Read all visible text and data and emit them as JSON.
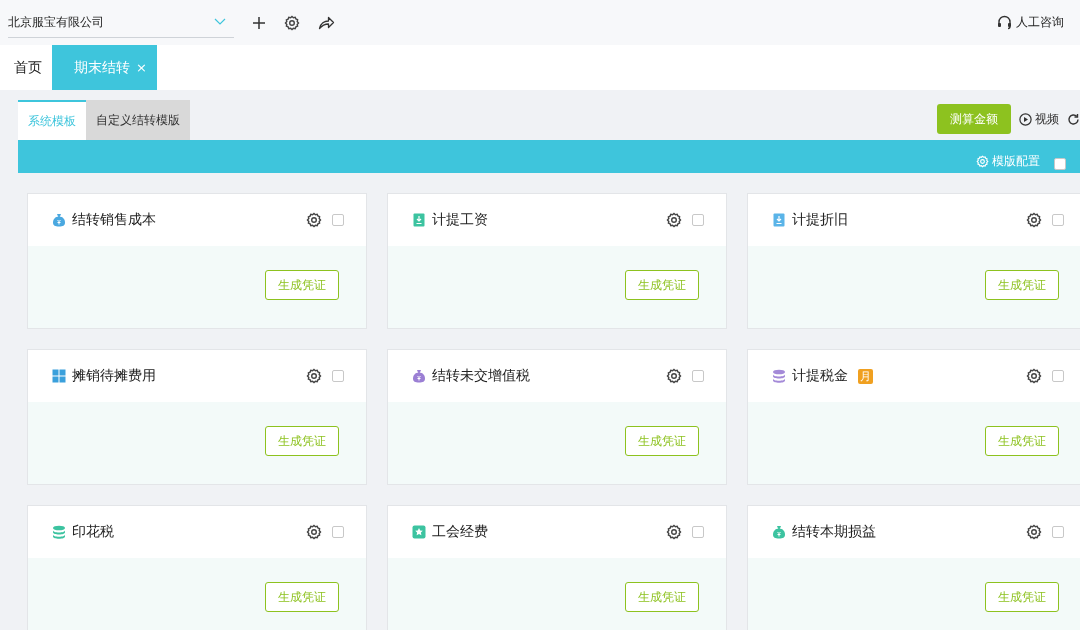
{
  "top_bar": {
    "company": "北京服宝有限公司",
    "support": "人工咨询"
  },
  "page_tabs": [
    {
      "label": "首页",
      "selected": false,
      "closable": false
    },
    {
      "label": "期末结转",
      "selected": true,
      "closable": true
    }
  ],
  "close_glyph": "×",
  "template_tabs": [
    {
      "label": "系统模板",
      "selected": true
    },
    {
      "label": "自定义结转模版",
      "selected": false
    }
  ],
  "actions": {
    "calculate": "测算金额",
    "video": "视频"
  },
  "band": {
    "config": "模版配置",
    "select_all": {
      "checked": false
    }
  },
  "cards": [
    {
      "title": "结转销售成本",
      "kind": "bag",
      "color": "#4aa8e0",
      "checked": false,
      "button": "生成凭证"
    },
    {
      "title": "计提工资",
      "kind": "doc",
      "color": "#3cc3a0",
      "checked": false,
      "button": "生成凭证"
    },
    {
      "title": "计提折旧",
      "kind": "doc",
      "color": "#5ab4e8",
      "checked": false,
      "button": "生成凭证"
    },
    {
      "title": "摊销待摊费用",
      "kind": "grid",
      "color": "#3aa0dc",
      "checked": false,
      "button": "生成凭证"
    },
    {
      "title": "结转未交增值税",
      "kind": "bag",
      "color": "#9b7fd4",
      "checked": false,
      "button": "生成凭证"
    },
    {
      "title": "计提税金",
      "kind": "coins",
      "color": "#a48ad8",
      "checked": false,
      "button": "生成凭证",
      "badge": "月"
    },
    {
      "title": "印花税",
      "kind": "coins",
      "color": "#3cc3a0",
      "checked": false,
      "button": "生成凭证"
    },
    {
      "title": "工会经费",
      "kind": "shield",
      "color": "#3cc3a0",
      "checked": false,
      "button": "生成凭证"
    },
    {
      "title": "结转本期损益",
      "kind": "bag",
      "color": "#3cc3a0",
      "checked": false,
      "button": "生成凭证"
    }
  ]
}
